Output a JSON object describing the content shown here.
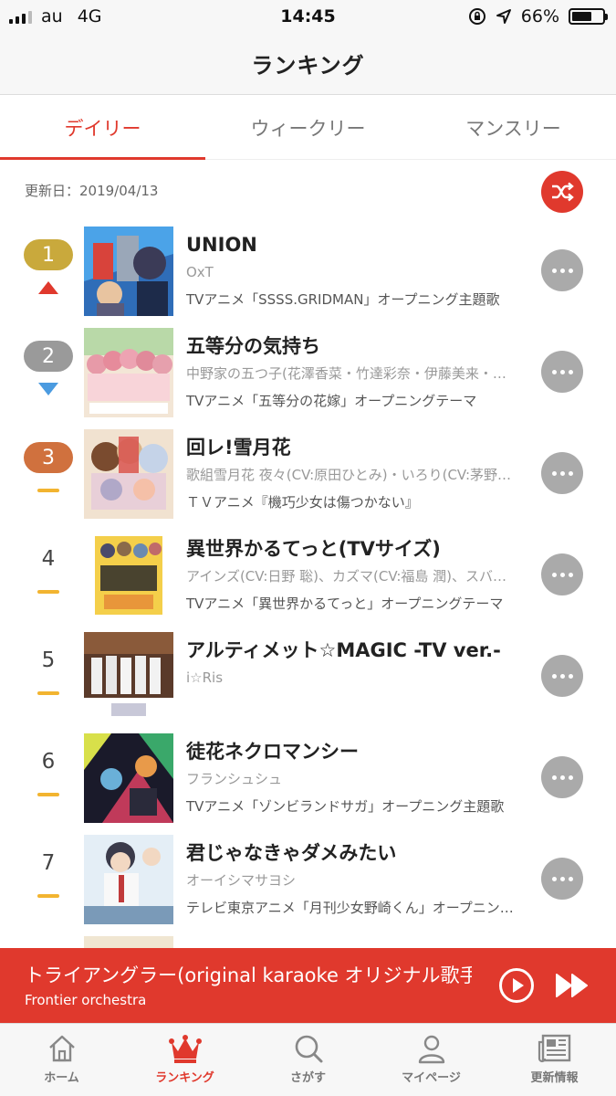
{
  "status_bar": {
    "carrier": "au",
    "network": "4G",
    "time": "14:45",
    "battery": "66%",
    "battery_level": 0.66
  },
  "header": {
    "title": "ランキング"
  },
  "tabs": [
    {
      "label": "デイリー",
      "active": true
    },
    {
      "label": "ウィークリー",
      "active": false
    },
    {
      "label": "マンスリー",
      "active": false
    }
  ],
  "update_date": "更新日：2019/04/13",
  "ranking": [
    {
      "rank": "1",
      "trend": "up",
      "title": "UNION",
      "artist": "OxT",
      "description": "TVアニメ「SSSS.GRIDMAN」オープニング主題歌"
    },
    {
      "rank": "2",
      "trend": "down",
      "title": "五等分の気持ち",
      "artist": "中野家の五つ子(花澤香菜・竹達彩奈・伊藤美来・…",
      "description": "TVアニメ「五等分の花嫁」オープニングテーマ"
    },
    {
      "rank": "3",
      "trend": "same",
      "title": "回レ!雪月花",
      "artist": "歌組雪月花 夜々(CV:原田ひとみ)・いろり(CV:茅野…",
      "description": "ＴＶアニメ『機巧少女は傷つかない』"
    },
    {
      "rank": "4",
      "trend": "same",
      "title": "異世界かるてっと(TVサイズ)",
      "artist": "アインズ(CV:日野 聡)、カズマ(CV:福島 潤)、スバ…",
      "description": "TVアニメ「異世界かるてっと」オープニングテーマ"
    },
    {
      "rank": "5",
      "trend": "same",
      "title": "アルティメット☆MAGIC -TV ver.-",
      "artist": "i☆Ris",
      "description": ""
    },
    {
      "rank": "6",
      "trend": "same",
      "title": "徒花ネクロマンシー",
      "artist": "フランシュシュ",
      "description": "TVアニメ「ゾンビランドサガ」オープニング主題歌"
    },
    {
      "rank": "7",
      "trend": "same",
      "title": "君じゃなきゃダメみたい",
      "artist": "オーイシマサヨシ",
      "description": "テレビ東京アニメ「月刊少女野崎くん」オープニン…"
    }
  ],
  "player": {
    "title": "トライアングラー(original karaoke オリジナル歌手",
    "artist": "Frontier orchestra"
  },
  "tab_bar": [
    {
      "label": "ホーム",
      "icon": "home-icon",
      "active": false
    },
    {
      "label": "ランキング",
      "icon": "crown-icon",
      "active": true
    },
    {
      "label": "さがす",
      "icon": "search-icon",
      "active": false
    },
    {
      "label": "マイページ",
      "icon": "person-icon",
      "active": false
    },
    {
      "label": "更新情報",
      "icon": "newspaper-icon",
      "active": false
    }
  ],
  "colors": {
    "accent": "#e0392d",
    "rank_gold": "#c9a93c",
    "rank_silver": "#9a9a9a",
    "rank_bronze": "#d0713e",
    "trend_up": "#e0392d",
    "trend_down": "#4b9be0",
    "trend_same": "#f2b430"
  }
}
